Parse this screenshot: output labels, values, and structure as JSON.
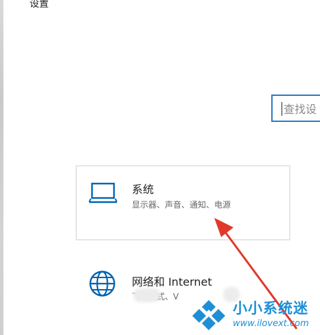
{
  "window": {
    "title": "设置"
  },
  "search": {
    "placeholder": "查找设"
  },
  "categories": [
    {
      "title": "系统",
      "description": "显示器、声音、通知、电源",
      "icon": "laptop-icon"
    },
    {
      "title": "网络和 Internet",
      "description": "飞行模式、V",
      "icon": "globe-icon"
    }
  ],
  "watermark": {
    "name": "小小系统迷",
    "url": "www.ilovext.com",
    "icon": "diamond-logo-icon"
  },
  "colors": {
    "accent": "#0063b1",
    "search_border": "#2a78c7",
    "annotation_arrow": "#e0392b",
    "watermark": "#1e8fd6"
  }
}
